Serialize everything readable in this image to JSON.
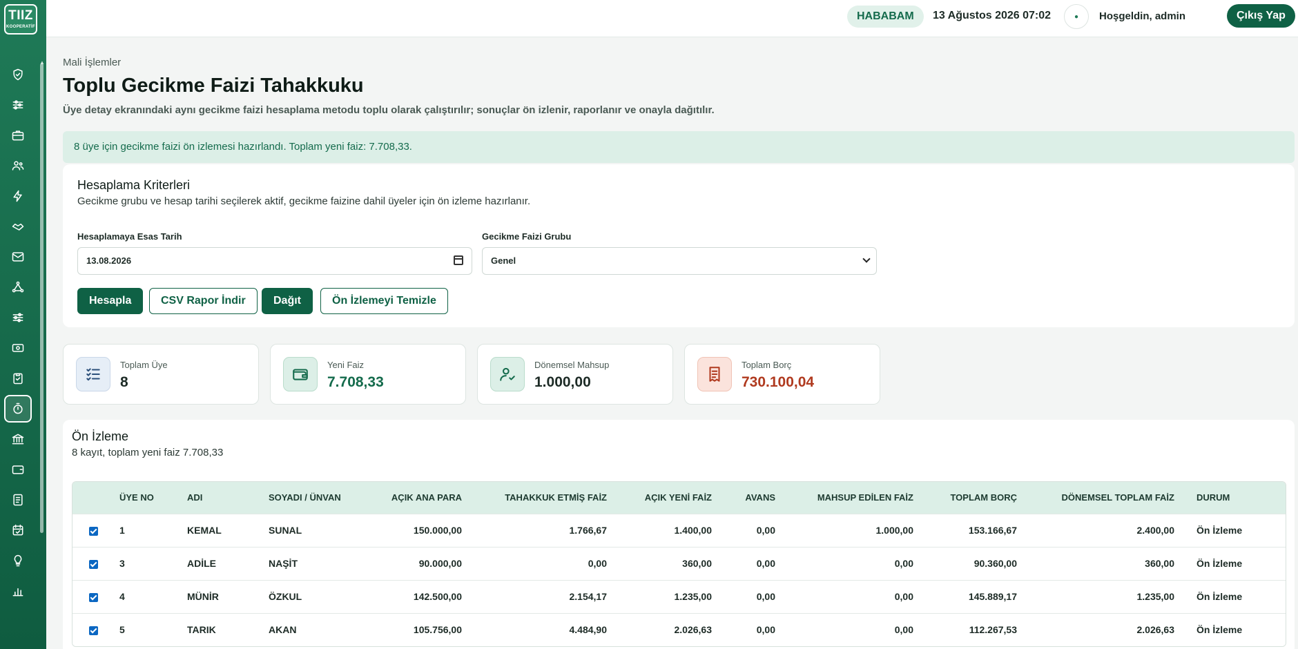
{
  "brand": {
    "logo_top": "TIIZ",
    "logo_bottom": "KOOPERATİF"
  },
  "topbar": {
    "coop_badge": "HABABAM",
    "datetime": "13 Ağustos 2026 07:02",
    "welcome": "Hoşgeldin, admin",
    "logout_label": "Çıkış Yap"
  },
  "page": {
    "breadcrumb": "Mali İşlemler",
    "title": "Toplu Gecikme Faizi Tahakkuku",
    "description": "Üye detay ekranındaki aynı gecikme faizi hesaplama metodu toplu olarak çalıştırılır; sonuçlar ön izlenir, raporlanır ve onayla dağıtılır.",
    "alert": "8 üye için gecikme faizi ön izlemesi hazırlandı. Toplam yeni faiz: 7.708,33."
  },
  "criteria": {
    "title": "Hesaplama Kriterleri",
    "subtitle": "Gecikme grubu ve hesap tarihi seçilerek aktif, gecikme faizine dahil üyeler için ön izleme hazırlanır.",
    "date_label": "Hesaplamaya Esas Tarih",
    "date_value": "13.08.2026",
    "group_label": "Gecikme Faizi Grubu",
    "group_value": "Genel",
    "buttons": {
      "calculate": "Hesapla",
      "csv": "CSV Rapor İndir",
      "distribute": "Dağıt",
      "clear": "Ön İzlemeyi Temizle"
    }
  },
  "stats": [
    {
      "label": "Toplam Üye",
      "value": "8",
      "color": "#1d2b26"
    },
    {
      "label": "Yeni Faiz",
      "value": "7.708,33",
      "color": "#146b4c"
    },
    {
      "label": "Dönemsel Mahsup",
      "value": "1.000,00",
      "color": "#1d2b26"
    },
    {
      "label": "Toplam Borç",
      "value": "730.100,04",
      "color": "#b03a1f"
    }
  ],
  "preview": {
    "title": "Ön İzleme",
    "subtitle": "8 kayıt, toplam yeni faiz 7.708,33",
    "columns": [
      "",
      "ÜYE NO",
      "ADI",
      "SOYADI / ÜNVAN",
      "AÇIK ANA PARA",
      "TAHAKKUK ETMİŞ FAİZ",
      "AÇIK YENİ FAİZ",
      "AVANS",
      "MAHSUP EDİLEN FAİZ",
      "TOPLAM BORÇ",
      "DÖNEMSEL TOPLAM FAİZ",
      "DURUM"
    ],
    "rows": [
      [
        "1",
        "KEMAL",
        "SUNAL",
        "150.000,00",
        "1.766,67",
        "1.400,00",
        "0,00",
        "1.000,00",
        "153.166,67",
        "2.400,00",
        "Ön İzleme"
      ],
      [
        "3",
        "ADİLE",
        "NAŞİT",
        "90.000,00",
        "0,00",
        "360,00",
        "0,00",
        "0,00",
        "90.360,00",
        "360,00",
        "Ön İzleme"
      ],
      [
        "4",
        "MÜNİR",
        "ÖZKUL",
        "142.500,00",
        "2.154,17",
        "1.235,00",
        "0,00",
        "0,00",
        "145.889,17",
        "1.235,00",
        "Ön İzleme"
      ],
      [
        "5",
        "TARIK",
        "AKAN",
        "105.756,00",
        "4.484,90",
        "2.026,63",
        "0,00",
        "0,00",
        "112.267,53",
        "2.026,63",
        "Ön İzleme"
      ]
    ]
  }
}
